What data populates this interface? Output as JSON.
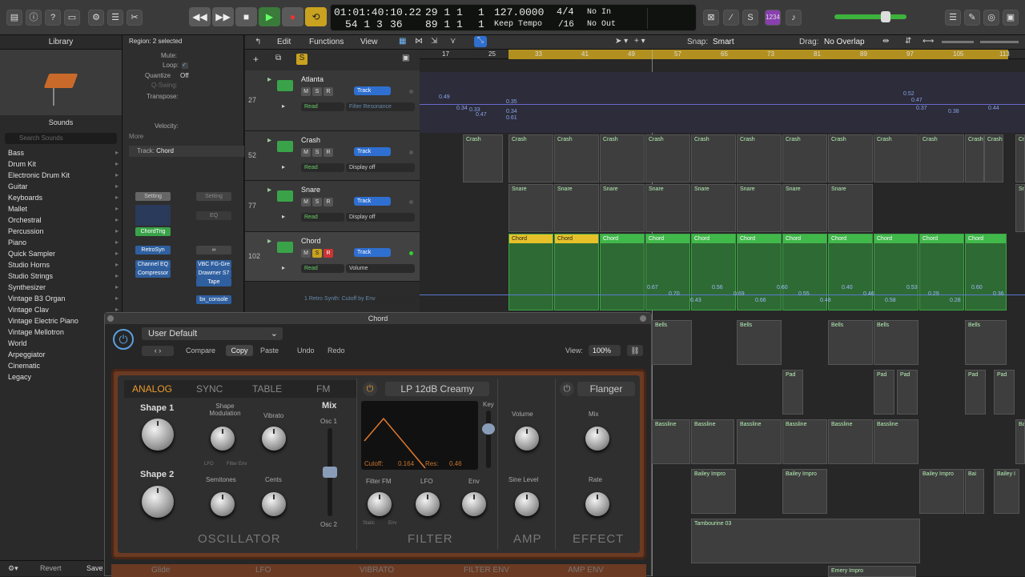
{
  "transport": {
    "position": "01:01:40:10.22",
    "bars": "29  1  1",
    "bars_sub": "1",
    "bars2": "54  1  3",
    "bars2_sub": "36",
    "bars3": "89  1  1",
    "bars3_sub": "1",
    "tempo": "127.0000",
    "tempo_label": "Keep Tempo",
    "sig": "4/4",
    "sig_div": "/16",
    "in": "No In",
    "out": "No Out"
  },
  "library": {
    "title": "Library",
    "sounds_label": "Sounds",
    "search_placeholder": "Search Sounds",
    "items": [
      "Bass",
      "Drum Kit",
      "Electronic Drum Kit",
      "Guitar",
      "Keyboards",
      "Mallet",
      "Orchestral",
      "Percussion",
      "Piano",
      "Quick Sampler",
      "Studio Horns",
      "Studio Strings",
      "Synthesizer",
      "Vintage B3 Organ",
      "Vintage Clav",
      "Vintage Electric Piano",
      "Vintage Mellotron",
      "World",
      "Arpeggiator",
      "Cinematic",
      "Legacy"
    ]
  },
  "inspector": {
    "region": "Region: 2 selected",
    "mute": "Mute:",
    "loop": "Loop:",
    "quantize": "Quantize",
    "quantize_val": "Off",
    "qswing": "Q-Swing:",
    "transpose": "Transpose:",
    "velocity": "Velocity:",
    "more": "More",
    "track": "Track:",
    "track_name": "Chord",
    "setting": "Setting",
    "eq": "EQ",
    "retrosyn": "RetroSyn",
    "chordtrig": "ChordTrig",
    "channel_eq": "Channel EQ",
    "compressor": "Compressor",
    "vbc": "VBC FG-Gre",
    "drawmer": "Drawmer S7",
    "tape": "Tape",
    "bx": "bx_console",
    "revert": "Revert",
    "save": "Save"
  },
  "menubar": {
    "edit": "Edit",
    "functions": "Functions",
    "view": "View",
    "snap_label": "Snap:",
    "snap": "Smart",
    "drag_label": "Drag:",
    "drag": "No Overlap"
  },
  "ruler": [
    "17",
    "25",
    "33",
    "41",
    "49",
    "57",
    "65",
    "73",
    "81",
    "89",
    "97",
    "105",
    "113"
  ],
  "tracks": [
    {
      "num": "27",
      "name": "Atlanta",
      "read": "Read",
      "auto": "Filter Resonance",
      "track": "Track"
    },
    {
      "num": "52",
      "name": "Crash",
      "read": "Read",
      "auto": "Display off",
      "track": "Track"
    },
    {
      "num": "77",
      "name": "Snare",
      "read": "Read",
      "auto": "Display off",
      "track": "Track"
    },
    {
      "num": "102",
      "name": "Chord",
      "read": "Read",
      "auto": "Volume",
      "track": "Track",
      "sub": "1 Retro Synth: Cutoff by Env"
    }
  ],
  "regions": {
    "crash": "Crash",
    "snare": "Snare",
    "chord": "Chord",
    "bells": "Bells",
    "pad": "Pad",
    "bassline": "Bassline",
    "bailey": "Bailey Impro",
    "bai": "Bai",
    "baileyI": "Bailey I",
    "tamb": "Tambourine 03",
    "emery": "Emery Impro"
  },
  "auto_values_atlanta": [
    "0.49",
    "0.34",
    "0.33",
    "0.47",
    "0.35",
    "0.34",
    "0.61",
    "0.52",
    "0.47",
    "0.37",
    "0.38",
    "0.44"
  ],
  "auto_values_chord": [
    "0.67",
    "0.70",
    "0.43",
    "0.56",
    "0.69",
    "0.66",
    "0.60",
    "0.55",
    "0.48",
    "0.40",
    "0.46",
    "0.58",
    "0.53",
    "0.29",
    "0.28",
    "0.60",
    "0.36"
  ],
  "plugin": {
    "title": "Chord",
    "preset": "User Default",
    "compare": "Compare",
    "copy": "Copy",
    "paste": "Paste",
    "undo": "Undo",
    "redo": "Redo",
    "view_label": "View:",
    "view": "100%",
    "tabs": [
      "ANALOG",
      "SYNC",
      "TABLE",
      "FM"
    ],
    "filter_type": "LP 12dB Creamy",
    "flanger": "Flanger",
    "shape1": "Shape 1",
    "shape2": "Shape 2",
    "shape_mod": "Shape Modulation",
    "vibrato": "Vibrato",
    "mix": "Mix",
    "osc1": "Osc 1",
    "osc2": "Osc 2",
    "semitones": "Semitones",
    "cents": "Cents",
    "lfo": "LFO",
    "filter_env": "Filter Env",
    "key": "Key",
    "cutoff": "Cutoff:",
    "cutoff_val": "0.164",
    "res": "Res:",
    "res_val": "0.46",
    "filter_fm": "Filter FM",
    "lfo2": "LFO",
    "env": "Env",
    "static": "Static",
    "env2": "Env",
    "volume": "Volume",
    "sine": "Sine Level",
    "mix2": "Mix",
    "rate": "Rate",
    "oscillator": "OSCILLATOR",
    "filter": "FILTER",
    "amp": "AMP",
    "effect": "EFFECT",
    "bottom": [
      "Glide",
      "LFO",
      "VIBRATO",
      "FILTER ENV",
      "AMP ENV"
    ]
  },
  "colors": {
    "accent": "#e89a2c",
    "green": "#41b84a",
    "track_blue": "#3a7bd5"
  }
}
